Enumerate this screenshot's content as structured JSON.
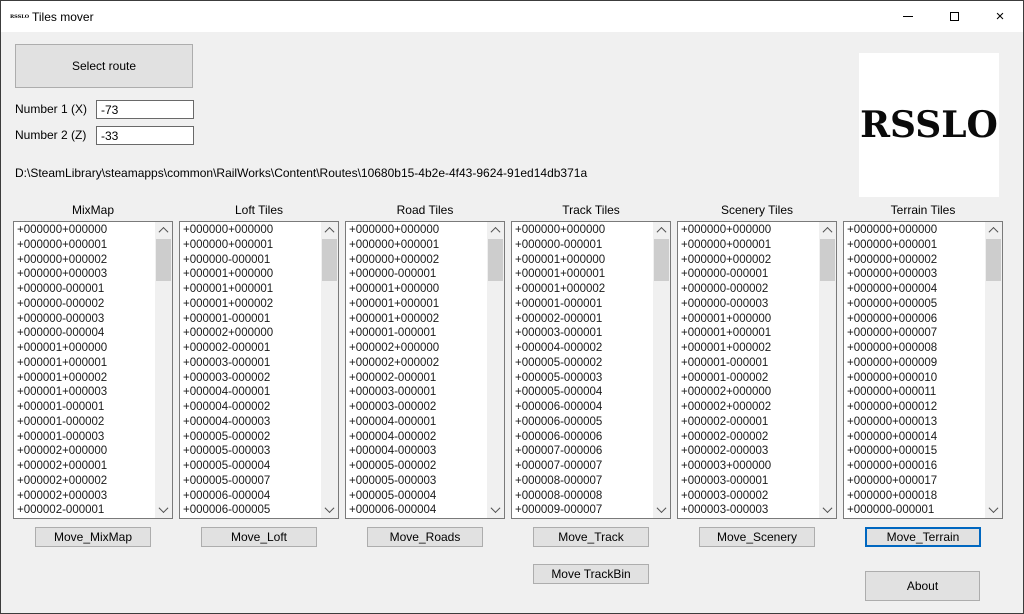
{
  "window": {
    "title": "Tiles mover",
    "icon_text": "RSSLO",
    "close_glyph": "×"
  },
  "form": {
    "select_route_label": "Select route",
    "number1_label": "Number 1 (X)",
    "number1_value": "-73",
    "number2_label": "Number 2 (Z)",
    "number2_value": "-33",
    "route_path": "D:\\SteamLibrary\\steamapps\\common\\RailWorks\\Content\\Routes\\10680b15-4b2e-4f43-9624-91ed14db371a"
  },
  "logo_text": "RSSLO",
  "columns": [
    {
      "header": "MixMap",
      "move_label": "Move_MixMap",
      "items": [
        "+000000+000000",
        "+000000+000001",
        "+000000+000002",
        "+000000+000003",
        "+000000-000001",
        "+000000-000002",
        "+000000-000003",
        "+000000-000004",
        "+000001+000000",
        "+000001+000001",
        "+000001+000002",
        "+000001+000003",
        "+000001-000001",
        "+000001-000002",
        "+000001-000003",
        "+000002+000000",
        "+000002+000001",
        "+000002+000002",
        "+000002+000003",
        "+000002-000001"
      ]
    },
    {
      "header": "Loft Tiles",
      "move_label": "Move_Loft",
      "items": [
        "+000000+000000",
        "+000000+000001",
        "+000000-000001",
        "+000001+000000",
        "+000001+000001",
        "+000001+000002",
        "+000001-000001",
        "+000002+000000",
        "+000002-000001",
        "+000003-000001",
        "+000003-000002",
        "+000004-000001",
        "+000004-000002",
        "+000004-000003",
        "+000005-000002",
        "+000005-000003",
        "+000005-000004",
        "+000005-000007",
        "+000006-000004",
        "+000006-000005"
      ]
    },
    {
      "header": "Road Tiles",
      "move_label": "Move_Roads",
      "items": [
        "+000000+000000",
        "+000000+000001",
        "+000000+000002",
        "+000000-000001",
        "+000001+000000",
        "+000001+000001",
        "+000001+000002",
        "+000001-000001",
        "+000002+000000",
        "+000002+000002",
        "+000002-000001",
        "+000003-000001",
        "+000003-000002",
        "+000004-000001",
        "+000004-000002",
        "+000004-000003",
        "+000005-000002",
        "+000005-000003",
        "+000005-000004",
        "+000006-000004"
      ]
    },
    {
      "header": "Track Tiles",
      "move_label": "Move_Track",
      "items": [
        "+000000+000000",
        "+000000-000001",
        "+000001+000000",
        "+000001+000001",
        "+000001+000002",
        "+000001-000001",
        "+000002-000001",
        "+000003-000001",
        "+000004-000002",
        "+000005-000002",
        "+000005-000003",
        "+000005-000004",
        "+000006-000004",
        "+000006-000005",
        "+000006-000006",
        "+000007-000006",
        "+000007-000007",
        "+000008-000007",
        "+000008-000008",
        "+000009-000007"
      ]
    },
    {
      "header": "Scenery Tiles",
      "move_label": "Move_Scenery",
      "items": [
        "+000000+000000",
        "+000000+000001",
        "+000000+000002",
        "+000000-000001",
        "+000000-000002",
        "+000000-000003",
        "+000001+000000",
        "+000001+000001",
        "+000001+000002",
        "+000001-000001",
        "+000001-000002",
        "+000002+000000",
        "+000002+000002",
        "+000002-000001",
        "+000002-000002",
        "+000002-000003",
        "+000003+000000",
        "+000003-000001",
        "+000003-000002",
        "+000003-000003"
      ]
    },
    {
      "header": "Terrain Tiles",
      "move_label": "Move_Terrain",
      "items": [
        "+000000+000000",
        "+000000+000001",
        "+000000+000002",
        "+000000+000003",
        "+000000+000004",
        "+000000+000005",
        "+000000+000006",
        "+000000+000007",
        "+000000+000008",
        "+000000+000009",
        "+000000+000010",
        "+000000+000011",
        "+000000+000012",
        "+000000+000013",
        "+000000+000014",
        "+000000+000015",
        "+000000+000016",
        "+000000+000017",
        "+000000+000018",
        "+000000-000001"
      ]
    }
  ],
  "bottom": {
    "move_trackbin_label": "Move TrackBin",
    "about_label": "About"
  },
  "colors": {
    "window_bg": "#f0f0f0",
    "titlebar_bg": "#ffffff",
    "button_bg": "#e1e1e1",
    "focus_accent": "#0067c0",
    "scroll_thumb": "#cdcdcd"
  }
}
